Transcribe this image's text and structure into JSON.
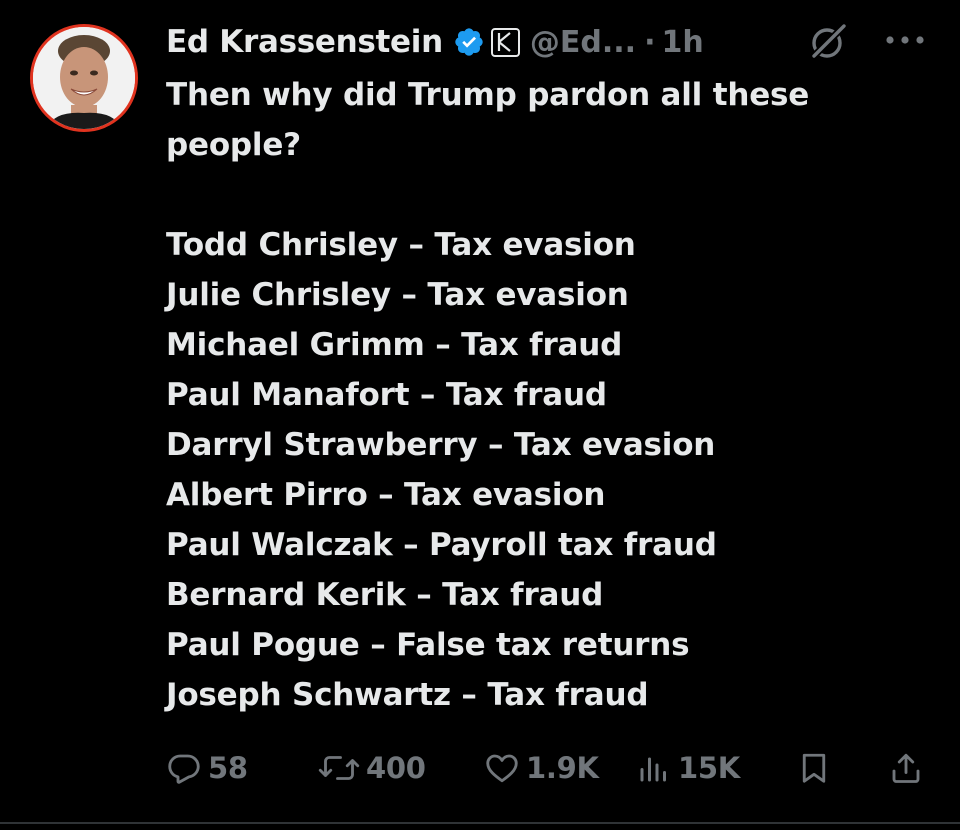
{
  "author": {
    "name": "Ed Krassenstein",
    "handle": "@Ed...",
    "separator": "·",
    "time": "1h",
    "affiliation_letter": "K"
  },
  "icons": {
    "verified": "verified-badge-icon",
    "grok": "grok-icon",
    "more": "more-icon",
    "reply": "reply-icon",
    "repost": "repost-icon",
    "like": "like-icon",
    "views": "views-icon",
    "bookmark": "bookmark-icon",
    "share": "share-icon"
  },
  "colors": {
    "background": "#000000",
    "text": "#e7e9ea",
    "secondary": "#71767b",
    "verified": "#1d9bf0",
    "avatar_ring": "#e0331f"
  },
  "tweet": {
    "intro_lines": [
      "Then why did Trump pardon all these",
      "people?"
    ],
    "list": [
      "Todd Chrisley – Tax evasion",
      "Julie Chrisley – Tax evasion",
      "Michael Grimm – Tax fraud",
      "Paul Manafort – Tax fraud",
      "Darryl Strawberry – Tax evasion",
      "Albert Pirro – Tax evasion",
      "Paul Walczak – Payroll tax fraud",
      "Bernard Kerik – Tax fraud",
      "Paul Pogue – False tax returns",
      "Joseph Schwartz – Tax fraud"
    ]
  },
  "metrics": {
    "replies": "58",
    "reposts": "400",
    "likes": "1.9K",
    "views": "15K"
  }
}
